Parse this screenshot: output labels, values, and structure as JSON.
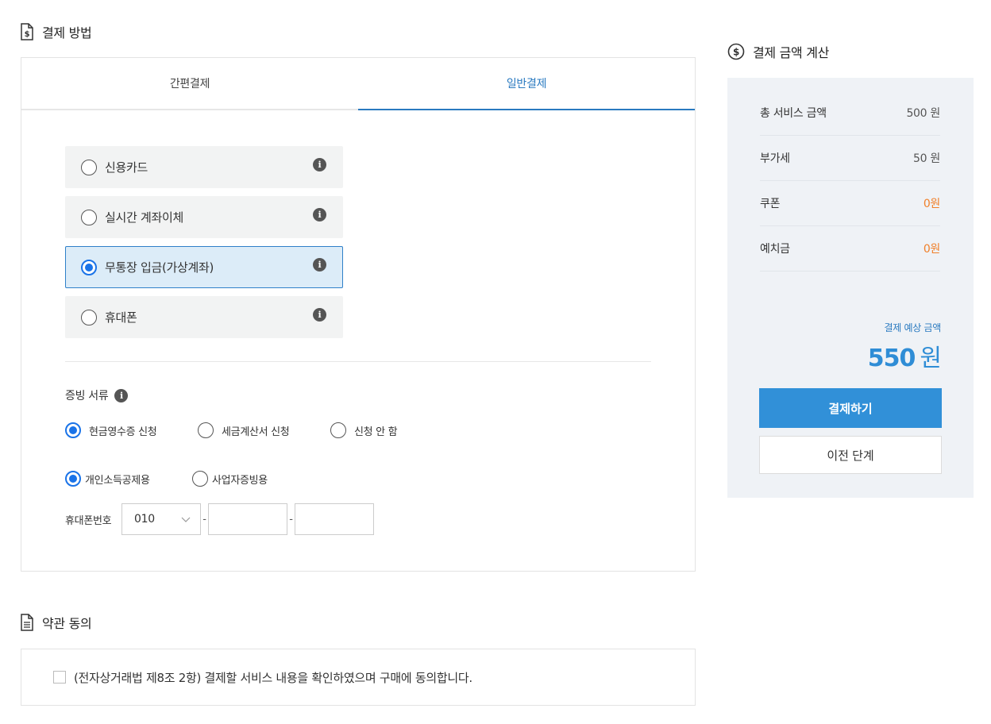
{
  "payment_section": {
    "title": "결제 방법",
    "tabs": [
      {
        "label": "간편결제",
        "active": false
      },
      {
        "label": "일반결제",
        "active": true
      }
    ],
    "methods": [
      {
        "label": "신용카드",
        "selected": false
      },
      {
        "label": "실시간 계좌이체",
        "selected": false
      },
      {
        "label": "무통장 입금(가상계좌)",
        "selected": true
      },
      {
        "label": "휴대폰",
        "selected": false
      }
    ],
    "receipt": {
      "title": "증빙 서류",
      "types": [
        {
          "label": "현금영수증 신청",
          "selected": true
        },
        {
          "label": "세금계산서 신청",
          "selected": false
        },
        {
          "label": "신청 안 함",
          "selected": false
        }
      ],
      "purposes": [
        {
          "label": "개인소득공제용",
          "selected": true
        },
        {
          "label": "사업자증빙용",
          "selected": false
        }
      ],
      "phone": {
        "label": "휴대폰번호",
        "prefix": "010",
        "separator": "-",
        "middle": "",
        "last": ""
      }
    }
  },
  "terms_section": {
    "title": "약관 동의",
    "agree_text": "(전자상거래법 제8조 2항) 결제할 서비스 내용을 확인하였으며 구매에 동의합니다."
  },
  "summary": {
    "title": "결제 금액 계산",
    "rows": [
      {
        "label": "총 서비스 금액",
        "value": "500 원",
        "highlight": false
      },
      {
        "label": "부가세",
        "value": "50 원",
        "highlight": false
      },
      {
        "label": "쿠폰",
        "value": "0원",
        "highlight": true
      },
      {
        "label": "예치금",
        "value": "0원",
        "highlight": true
      }
    ],
    "expected_label": "결제 예상 금액",
    "expected_amount": "550",
    "expected_unit": "원",
    "pay_button": "결제하기",
    "prev_button": "이전 단계"
  },
  "colors": {
    "accent": "#3190d8",
    "tab_active": "#2a7ac0",
    "highlight_value": "#f0802a",
    "selected_bg": "#dcecf8",
    "summary_bg": "#eff2f6"
  }
}
